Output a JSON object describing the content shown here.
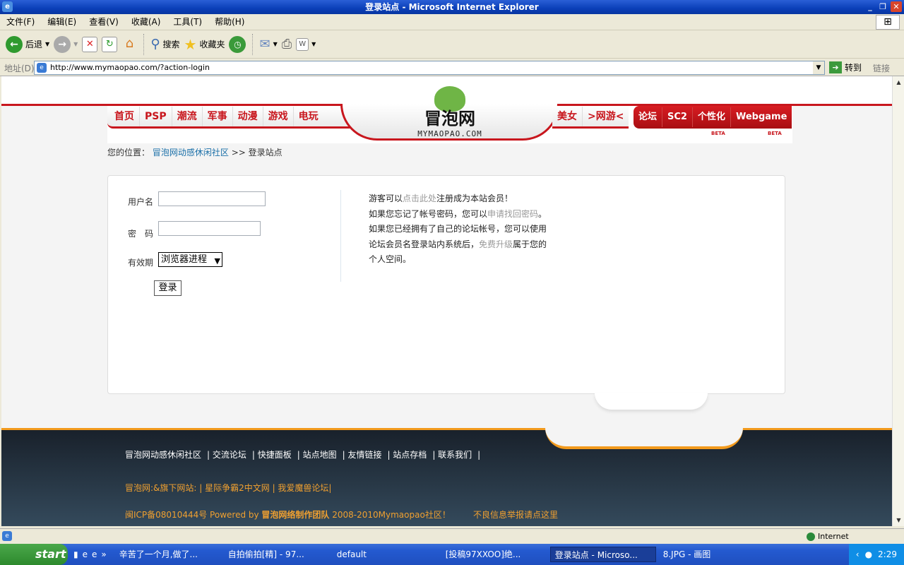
{
  "window": {
    "title": "登录站点 - Microsoft Internet Explorer",
    "minimize": "_",
    "restore": "❐",
    "close": "✕"
  },
  "menu": [
    "文件(F)",
    "编辑(E)",
    "查看(V)",
    "收藏(A)",
    "工具(T)",
    "帮助(H)"
  ],
  "toolbar": {
    "back": "后退",
    "search": "搜索",
    "favorites": "收藏夹"
  },
  "address": {
    "label": "地址(D)",
    "url": "http://www.mymaopao.com/?action-login",
    "go": "转到",
    "links": "链接"
  },
  "site": {
    "logo_cn": "冒泡网",
    "logo_en": "MYMAOPAO.COM",
    "nav_left": [
      "首页",
      "PSP",
      "潮流",
      "军事",
      "动漫",
      "游戏",
      "电玩"
    ],
    "nav_right": [
      "美女",
      ">网游<"
    ],
    "nav_red": [
      "论坛",
      "SC2",
      "个性化",
      "Webgame"
    ],
    "beta": "BETA",
    "breadcrumb": {
      "label": "您的位置：",
      "home": "冒泡网动感休闲社区",
      "sep": ">>",
      "current": "登录站点"
    }
  },
  "login": {
    "username_label": "用户名",
    "username_value": "",
    "password_label": "密　码",
    "password_value": "",
    "expiry_label": "有效期",
    "expiry_value": "浏览器进程",
    "submit": "登录",
    "info": {
      "l1a": "游客可以",
      "l1link": "点击此处",
      "l1b": "注册成为本站会员！",
      "l2a": "如果您忘记了帐号密码，您可以",
      "l2link": "申请找回密码",
      "l2b": "。",
      "l3": "如果您已经拥有了自己的论坛帐号，您可以使用",
      "l4a": "论坛会员名登录站内系统后，",
      "l4link": "免费升级",
      "l4b": "属于您的",
      "l5": "个人空间。"
    }
  },
  "footer": {
    "links": [
      "冒泡网动感休闲社区",
      "| 交流论坛",
      "| 快捷面板",
      "| 站点地图",
      "| 友情链接",
      "| 站点存档",
      "| 联系我们",
      "|"
    ],
    "sites": "冒泡网:&旗下网站: | 星际争霸2中文网 | 我爱魔兽论坛|",
    "icp": "闽ICP备08010444号  Powered by ",
    "team": "冒泡网络制作团队",
    "copyright": "  2008-2010Mymaopao社区！",
    "report": "不良信息举报请点这里"
  },
  "status": {
    "zone": "Internet"
  },
  "taskbar": {
    "start": "start",
    "tasks": [
      "辛苦了一个月,做了...",
      "自拍偷拍[精] - 97...",
      "default",
      "[投稿97XXOO]绝...",
      "登录站点 - Microso...",
      "8.JPG - 画图"
    ],
    "clock": "2:29"
  }
}
